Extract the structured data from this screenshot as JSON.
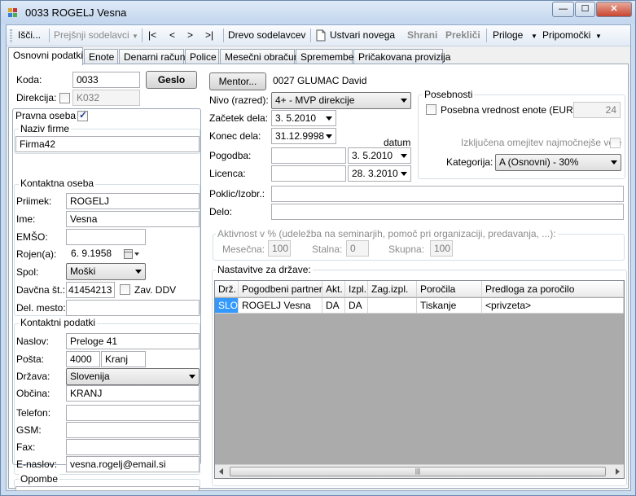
{
  "window": {
    "title": "0033 ROGELJ Vesna",
    "min": "—",
    "max": "☐",
    "close": "✕"
  },
  "toolbar": {
    "isci": "Išči...",
    "prejsnji": "Prejšnji sodelavci",
    "first": "|<",
    "prev": "<",
    "next": ">",
    "last": ">|",
    "drevo": "Drevo sodelavcev",
    "ustvari": "Ustvari novega",
    "shrani": "Shrani",
    "preklici": "Prekliči",
    "priloge": "Priloge",
    "pripomocki": "Pripomočki"
  },
  "tabs": [
    "Osnovni podatki",
    "Enote",
    "Denarni račun",
    "Police",
    "Mesečni obračun",
    "Spremembe",
    "Pričakovana provizija"
  ],
  "left": {
    "koda_label": "Koda:",
    "koda": "0033",
    "geslo": "Geslo",
    "direkcija_label": "Direkcija:",
    "direkcija": "K032",
    "pravna_label": "Pravna oseba",
    "naziv_title": "Naziv firme",
    "naziv": "Firma42",
    "kontaktna_title": "Kontaktna oseba",
    "priimek_label": "Priimek:",
    "priimek": "ROGELJ",
    "ime_label": "Ime:",
    "ime": "Vesna",
    "emso_label": "EMŠO:",
    "emso": "",
    "rojen_label": "Rojen(a):",
    "rojen": "6. 9.1958",
    "spol_label": "Spol:",
    "spol": "Moški",
    "davcna_label": "Davčna št.:",
    "davcna": "41454213",
    "zav_ddv_label": "Zav. DDV",
    "delmesto_label": "Del. mesto:",
    "delmesto": "",
    "kontaktni_title": "Kontaktni podatki",
    "naslov_label": "Naslov:",
    "naslov": "Preloge 41",
    "posta_label": "Pošta:",
    "posta_st": "4000",
    "posta_kraj": "Kranj",
    "drzava_label": "Država:",
    "drzava": "Slovenija",
    "obcina_label": "Občina:",
    "obcina": "KRANJ",
    "telefon_label": "Telefon:",
    "telefon": "",
    "gsm_label": "GSM:",
    "gsm": "",
    "fax_label": "Fax:",
    "fax": "",
    "email_label": "E-naslov:",
    "email": "vesna.rogelj@email.si",
    "opombe_title": "Opombe",
    "opombe": ""
  },
  "right": {
    "mentor_btn": "Mentor...",
    "mentor": "0027 GLUMAC David",
    "nivo_label": "Nivo (razred):",
    "nivo": "4+ - MVP direkcije",
    "zacetek_label": "Začetek dela:",
    "zacetek": "3. 5.2010",
    "konec_label": "Konec dela:",
    "konec": "31.12.9998",
    "datum_label": "datum",
    "pogodba_label": "Pogodba:",
    "pogodba": "",
    "pogodba_datum": "3. 5.2010",
    "licenca_label": "Licenca:",
    "licenca": "",
    "licenca_datum": "28. 3.2010",
    "poklic_label": "Poklic/Izobr.:",
    "poklic": "",
    "delo_label": "Delo:",
    "delo": "",
    "posebnosti_title": "Posebnosti",
    "posebna_label": "Posebna vrednost enote (EUR):",
    "posebna": "24",
    "izkljucena_label": "Izključena omejitev najmočnejše veje",
    "kategorija_label": "Kategorija:",
    "kategorija": "A (Osnovni) - 30%",
    "aktivnost_title": "Aktivnost v % (udeležba na seminarjih, pomoč pri organizaciji, predavanja, ...):",
    "mesecna_label": "Mesečna:",
    "mesecna": "100",
    "stalna_label": "Stalna:",
    "stalna": "0",
    "skupna_label": "Skupna:",
    "skupna": "100",
    "nastavitve_title": "Nastavitve za države:"
  },
  "grid": {
    "headers": [
      "Drž.",
      "Pogodbeni partner",
      "Akt.",
      "Izpl.",
      "Zag.izpl.",
      "Poročila",
      "Predloga za poročilo"
    ],
    "rows": [
      [
        "SLO",
        "ROGELJ Vesna",
        "DA",
        "DA",
        "",
        "Tiskanje",
        "<privzeta>"
      ]
    ]
  }
}
